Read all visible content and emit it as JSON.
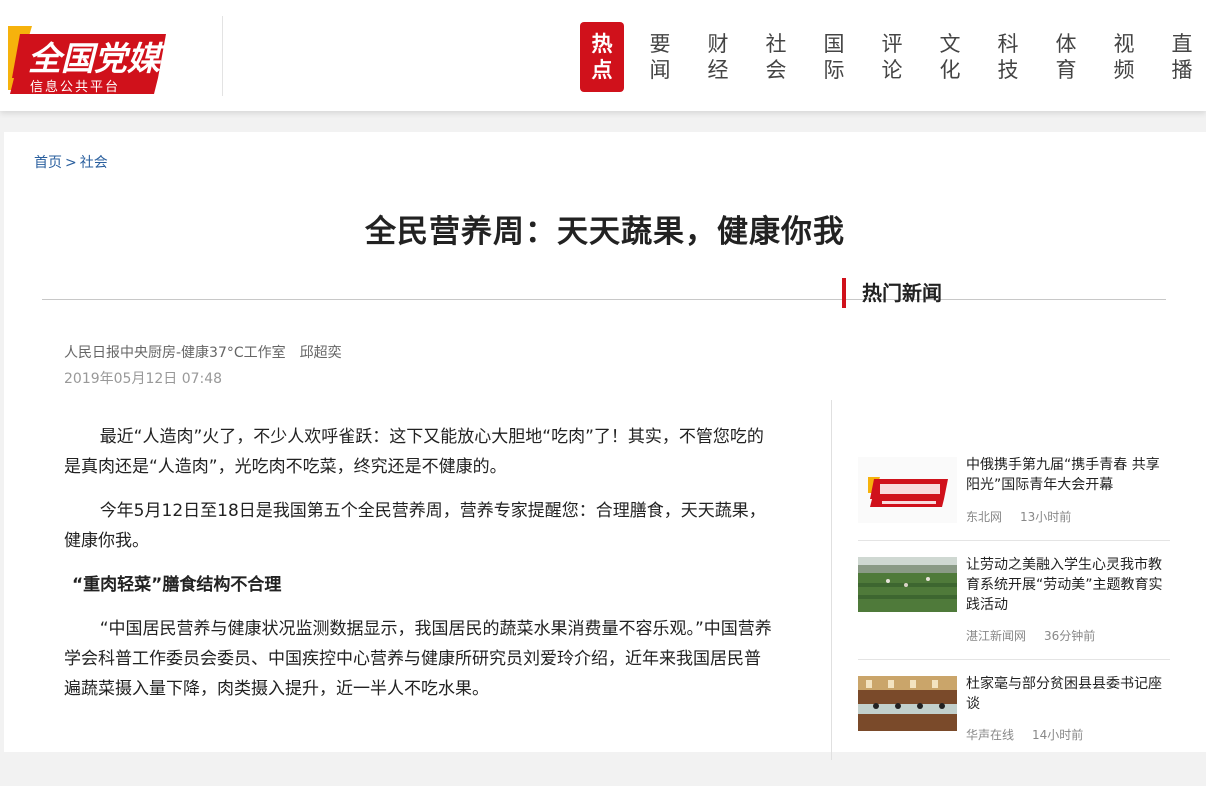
{
  "logo": {
    "main": "全国党媒",
    "sub": "信息公共平台"
  },
  "nav": [
    {
      "l1": "热",
      "l2": "点",
      "active": true
    },
    {
      "l1": "要",
      "l2": "闻"
    },
    {
      "l1": "财",
      "l2": "经"
    },
    {
      "l1": "社",
      "l2": "会"
    },
    {
      "l1": "国",
      "l2": "际"
    },
    {
      "l1": "评",
      "l2": "论"
    },
    {
      "l1": "文",
      "l2": "化"
    },
    {
      "l1": "科",
      "l2": "技"
    },
    {
      "l1": "体",
      "l2": "育"
    },
    {
      "l1": "视",
      "l2": "频"
    },
    {
      "l1": "直",
      "l2": "播"
    }
  ],
  "breadcrumb": {
    "home": "首页",
    "sep": ">",
    "section": "社会"
  },
  "article": {
    "title": "全民营养周：天天蔬果，健康你我",
    "author": "人民日报中央厨房-健康37°C工作室　邱超奕",
    "date": "2019年05月12日 07:48",
    "p1": "最近“人造肉”火了，不少人欢呼雀跃：这下又能放心大胆地“吃肉”了！其实，不管您吃的是真肉还是“人造肉”，光吃肉不吃菜，终究还是不健康的。",
    "p2": "今年5月12日至18日是我国第五个全民营养周，营养专家提醒您：合理膳食，天天蔬果，健康你我。",
    "h1": "“重肉轻菜”膳食结构不合理",
    "p3": "“中国居民营养与健康状况监测数据显示，我国居民的蔬菜水果消费量不容乐观。”中国营养学会科普工作委员会委员、中国疾控中心营养与健康所研究员刘爱玲介绍，近年来我国居民普遍蔬菜摄入量下降，肉类摄入提升，近一半人不吃水果。"
  },
  "sidebar": {
    "title": "热门新闻",
    "items": [
      {
        "headline": "中俄携手第九届“携手青春 共享阳光”国际青年大会开幕",
        "source": "东北网",
        "time": "13小时前"
      },
      {
        "headline": "让劳动之美融入学生心灵我市教育系统开展“劳动美”主题教育实践活动",
        "source": "湛江新闻网",
        "time": "36分钟前"
      },
      {
        "headline": "杜家毫与部分贫困县县委书记座谈",
        "source": "华声在线",
        "time": "14小时前"
      }
    ]
  }
}
